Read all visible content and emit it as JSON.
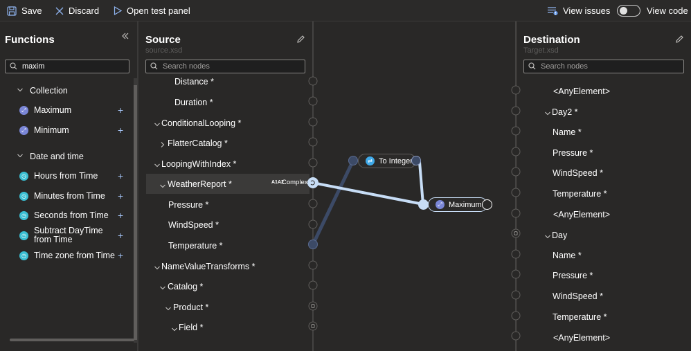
{
  "toolbar": {
    "save": "Save",
    "discard": "Discard",
    "open_test_panel": "Open test panel",
    "view_issues": "View issues",
    "view_code": "View code"
  },
  "functions": {
    "title": "Functions",
    "search_value": "maxim",
    "categories": [
      {
        "label": "Collection",
        "items": [
          "Maximum",
          "Minimum"
        ]
      },
      {
        "label": "Date and time",
        "items": [
          "Hours from Time",
          "Minutes from Time",
          "Seconds from Time",
          "Subtract DayTime",
          "from Time",
          "Time zone from Time"
        ]
      }
    ]
  },
  "source": {
    "title": "Source",
    "subtitle": "source.xsd",
    "search_placeholder": "Search nodes",
    "nodes": [
      "Distance *",
      "Duration *",
      "ConditionalLooping *",
      "FlatterCatalog *",
      "LoopingWithIndex *",
      "WeatherReport *",
      "Pressure *",
      "WindSpeed *",
      "Temperature *",
      "NameValueTransforms *",
      "Catalog *",
      "Product *",
      "Field *"
    ],
    "complex_label": "Complex",
    "complex_icon_text": "A1A2"
  },
  "canvas": {
    "to_integer": "To Integer",
    "maximum": "Maximum"
  },
  "destination": {
    "title": "Destination",
    "subtitle": "Target.xsd",
    "search_placeholder": "Search nodes",
    "nodes": [
      "<AnyElement>",
      "Day2 *",
      "Name *",
      "Pressure *",
      "WindSpeed *",
      "Temperature *",
      "<AnyElement>",
      "Day",
      "Name *",
      "Pressure *",
      "WindSpeed *",
      "Temperature *",
      "<AnyElement>"
    ]
  },
  "colors": {
    "background": "#292827",
    "connection_active": "#c7ddf6",
    "connection_dim": "#3c4a66",
    "accent": "#a4c2f4"
  }
}
